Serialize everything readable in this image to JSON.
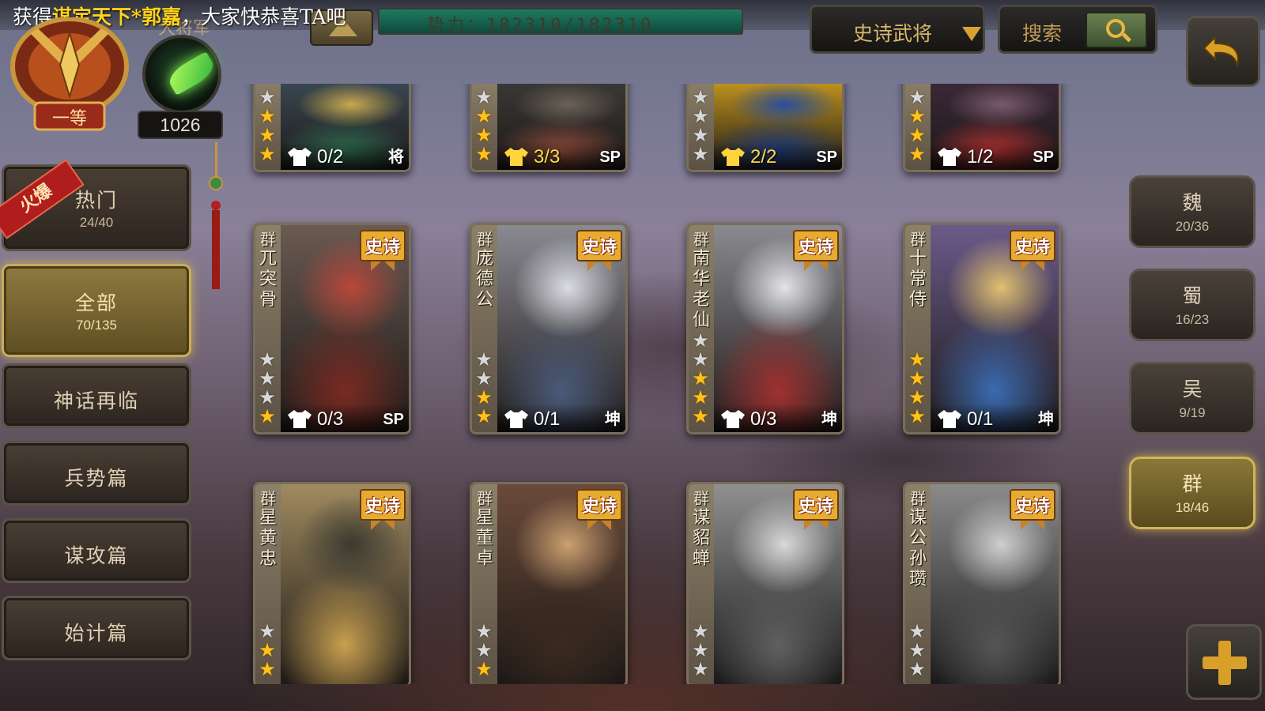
{
  "banner": {
    "prefix": "获得",
    "highlight": "谋定天下*郭嘉",
    "suffix": "，大家快恭喜TA吧"
  },
  "rank": {
    "title": "大将军"
  },
  "power": {
    "label": "势力：182310/182310",
    "current": 182310,
    "max": 182310
  },
  "filter_dropdown": {
    "selected": "史诗武将"
  },
  "search": {
    "label": "搜索"
  },
  "currency": {
    "value": "1026",
    "emblem_text": "一等"
  },
  "hot_ribbon": "火爆",
  "categories": [
    {
      "name": "热门",
      "count": "24/40",
      "active": false
    },
    {
      "name": "全部",
      "count": "70/135",
      "active": true
    },
    {
      "name": "神话再临",
      "count": "",
      "active": false
    },
    {
      "name": "兵势篇",
      "count": "",
      "active": false
    },
    {
      "name": "谋攻篇",
      "count": "",
      "active": false
    },
    {
      "name": "始计篇",
      "count": "",
      "active": false
    }
  ],
  "factions": [
    {
      "name": "魏",
      "count": "20/36",
      "active": false
    },
    {
      "name": "蜀",
      "count": "16/23",
      "active": false
    },
    {
      "name": "吴",
      "count": "9/19",
      "active": false
    },
    {
      "name": "群",
      "count": "18/46",
      "active": true
    }
  ],
  "epic_label": "史诗",
  "shirt_icon": "outfit-icon",
  "heroes": [
    {
      "faction": "",
      "name": "",
      "stars_on": 3,
      "stars_total": 4,
      "shards": "0/2",
      "badge": "将",
      "epic": false,
      "gray": false,
      "art": [
        "#3b4a55",
        "#c7a84f",
        "#2d6a4e"
      ]
    },
    {
      "faction": "",
      "name": "",
      "stars_on": 3,
      "stars_total": 4,
      "shards": "3/3",
      "badge": "SP",
      "epic": false,
      "gray": false,
      "art": [
        "#3c3a38",
        "#6b6257",
        "#8a4a3a"
      ]
    },
    {
      "faction": "",
      "name": "",
      "stars_on": 0,
      "stars_total": 4,
      "shards": "2/2",
      "badge": "SP",
      "epic": false,
      "gray": false,
      "art": [
        "#c99a1f",
        "#2a4f9a",
        "#1f3b78"
      ]
    },
    {
      "faction": "",
      "name": "",
      "stars_on": 3,
      "stars_total": 4,
      "shards": "1/2",
      "badge": "SP",
      "epic": false,
      "gray": false,
      "art": [
        "#3c2a3a",
        "#7a5a6a",
        "#b03030"
      ]
    },
    {
      "faction": "群",
      "name": "兀突骨",
      "stars_on": 1,
      "stars_total": 4,
      "shards": "0/3",
      "badge": "SP",
      "epic": true,
      "gray": false,
      "art": [
        "#6a5a52",
        "#b8473a",
        "#7a2a22"
      ]
    },
    {
      "faction": "群",
      "name": "庞德公",
      "stars_on": 2,
      "stars_total": 4,
      "shards": "0/1",
      "badge": "坤",
      "epic": true,
      "gray": false,
      "art": [
        "#8a8a92",
        "#dcdde4",
        "#4a5a7a"
      ]
    },
    {
      "faction": "群",
      "name": "南华老仙",
      "stars_on": 3,
      "stars_total": 5,
      "shards": "0/3",
      "badge": "坤",
      "epic": true,
      "gray": false,
      "art": [
        "#8a8a90",
        "#e4e4e8",
        "#a03030"
      ]
    },
    {
      "faction": "群",
      "name": "十常侍",
      "stars_on": 4,
      "stars_total": 4,
      "shards": "0/1",
      "badge": "坤",
      "epic": true,
      "gray": false,
      "art": [
        "#6a5a8a",
        "#e0c070",
        "#3a6ab0"
      ]
    },
    {
      "faction": "群",
      "name": "星黄忠",
      "stars_on": 2,
      "stars_total": 3,
      "shards": "",
      "badge": "",
      "epic": true,
      "gray": false,
      "art": [
        "#a08a60",
        "#3a3a30",
        "#c8a050"
      ]
    },
    {
      "faction": "群",
      "name": "星董卓",
      "stars_on": 1,
      "stars_total": 3,
      "shards": "",
      "badge": "",
      "epic": true,
      "gray": false,
      "art": [
        "#6a4a3a",
        "#caa070",
        "#3a2a20"
      ]
    },
    {
      "faction": "群",
      "name": "谋貂蝉",
      "stars_on": 0,
      "stars_total": 3,
      "shards": "",
      "badge": "",
      "epic": true,
      "gray": true,
      "art": [
        "#909090",
        "#d8d8d8",
        "#606060"
      ]
    },
    {
      "faction": "群",
      "name": "谋公孙瓒",
      "stars_on": 0,
      "stars_total": 3,
      "shards": "",
      "badge": "",
      "epic": true,
      "gray": true,
      "art": [
        "#8a8a8a",
        "#cfcfcf",
        "#555555"
      ]
    }
  ]
}
